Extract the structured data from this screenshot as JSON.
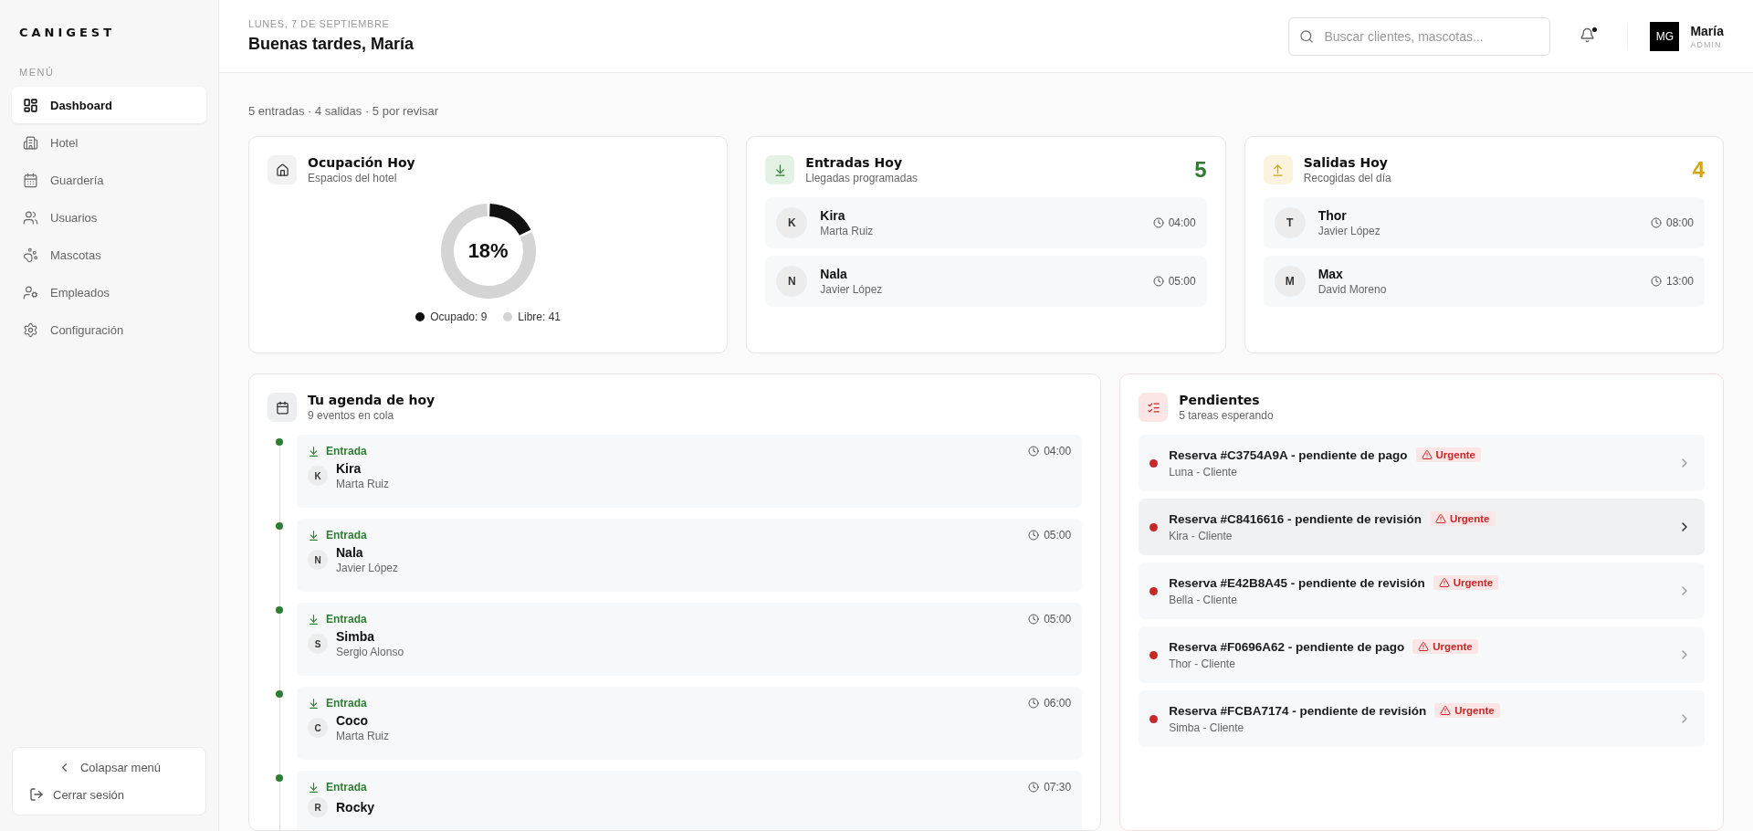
{
  "sidebar": {
    "logo": "CANIGEST",
    "section_label": "MENÚ",
    "items": [
      {
        "label": "Dashboard",
        "kind": "dashboard",
        "selected": true
      },
      {
        "label": "Hotel",
        "kind": "hotel",
        "selected": false
      },
      {
        "label": "Guardería",
        "kind": "calendar",
        "selected": false
      },
      {
        "label": "Usuarios",
        "kind": "users",
        "selected": false
      },
      {
        "label": "Mascotas",
        "kind": "paw",
        "selected": false
      },
      {
        "label": "Empleados",
        "kind": "user-cog",
        "selected": false
      },
      {
        "label": "Configuración",
        "kind": "settings",
        "selected": false
      }
    ],
    "collapse": "Colapsar menú",
    "logout": "Cerrar sesión"
  },
  "header": {
    "date": "LUNES, 7 DE SEPTIEMBRE",
    "greeting": "Buenas tardes, María",
    "search": {
      "placeholder": "Buscar clientes, mascotas..."
    },
    "notifications_unread": true,
    "user": {
      "initials": "MG",
      "name": "María",
      "role": "ADMIN"
    }
  },
  "summary": "5 entradas · 4 salidas · 5 por revisar",
  "occupancy": {
    "title": "Ocupación Hoy",
    "subtitle": "Espacios del hotel",
    "percent": "18%",
    "chart_data": {
      "type": "donut",
      "categories": [
        "Ocupado: 9",
        "Libre: 41"
      ],
      "values": [
        9,
        41
      ]
    },
    "legend": [
      {
        "color": "#111111"
      },
      {
        "color": "#d4d4d4"
      }
    ]
  },
  "arrivals": {
    "title": "Entradas Hoy",
    "subtitle": "Llegadas programadas",
    "count": "5",
    "kind": "in",
    "rows": [
      {
        "initial": "K",
        "name": "Kira",
        "owner": "Marta Ruiz",
        "time": "04:00"
      },
      {
        "initial": "N",
        "name": "Nala",
        "owner": "Javier López",
        "time": "05:00"
      }
    ]
  },
  "departures": {
    "title": "Salidas Hoy",
    "subtitle": "Recogidas del día",
    "count": "4",
    "kind": "out",
    "rows": [
      {
        "initial": "T",
        "name": "Thor",
        "owner": "Javier López",
        "time": "08:00"
      },
      {
        "initial": "M",
        "name": "Max",
        "owner": "David Moreno",
        "time": "13:00"
      }
    ]
  },
  "agenda": {
    "title": "Tu agenda de hoy",
    "subtitle": "9 eventos en cola",
    "events": [
      {
        "kind": "in",
        "type": "Entrada",
        "time": "04:00",
        "initial": "K",
        "name": "Kira",
        "owner": "Marta Ruiz"
      },
      {
        "kind": "in",
        "type": "Entrada",
        "time": "05:00",
        "initial": "N",
        "name": "Nala",
        "owner": "Javier López"
      },
      {
        "kind": "in",
        "type": "Entrada",
        "time": "05:00",
        "initial": "S",
        "name": "Simba",
        "owner": "Sergio Alonso"
      },
      {
        "kind": "in",
        "type": "Entrada",
        "time": "06:00",
        "initial": "C",
        "name": "Coco",
        "owner": "Marta Ruiz"
      },
      {
        "kind": "in",
        "type": "Entrada",
        "time": "07:30",
        "initial": "R",
        "name": "Rocky"
      }
    ]
  },
  "pending": {
    "title": "Pendientes",
    "subtitle": "5 tareas esperando",
    "tasks": [
      {
        "title": "Reserva #C3754A9A - pendiente de pago",
        "badge": "Urgente",
        "detail": "Luna - Cliente",
        "selected": false
      },
      {
        "title": "Reserva #C8416616 - pendiente de revisión",
        "badge": "Urgente",
        "detail": "Kira - Cliente",
        "selected": true
      },
      {
        "title": "Reserva #E42B8A45 - pendiente de revisión",
        "badge": "Urgente",
        "detail": "Bella - Cliente",
        "selected": false
      },
      {
        "title": "Reserva #F0696A62 - pendiente de pago",
        "badge": "Urgente",
        "detail": "Thor - Cliente",
        "selected": false
      },
      {
        "title": "Reserva #FCBA7174 - pendiente de revisión",
        "badge": "Urgente",
        "detail": "Simba - Cliente",
        "selected": false
      }
    ]
  }
}
